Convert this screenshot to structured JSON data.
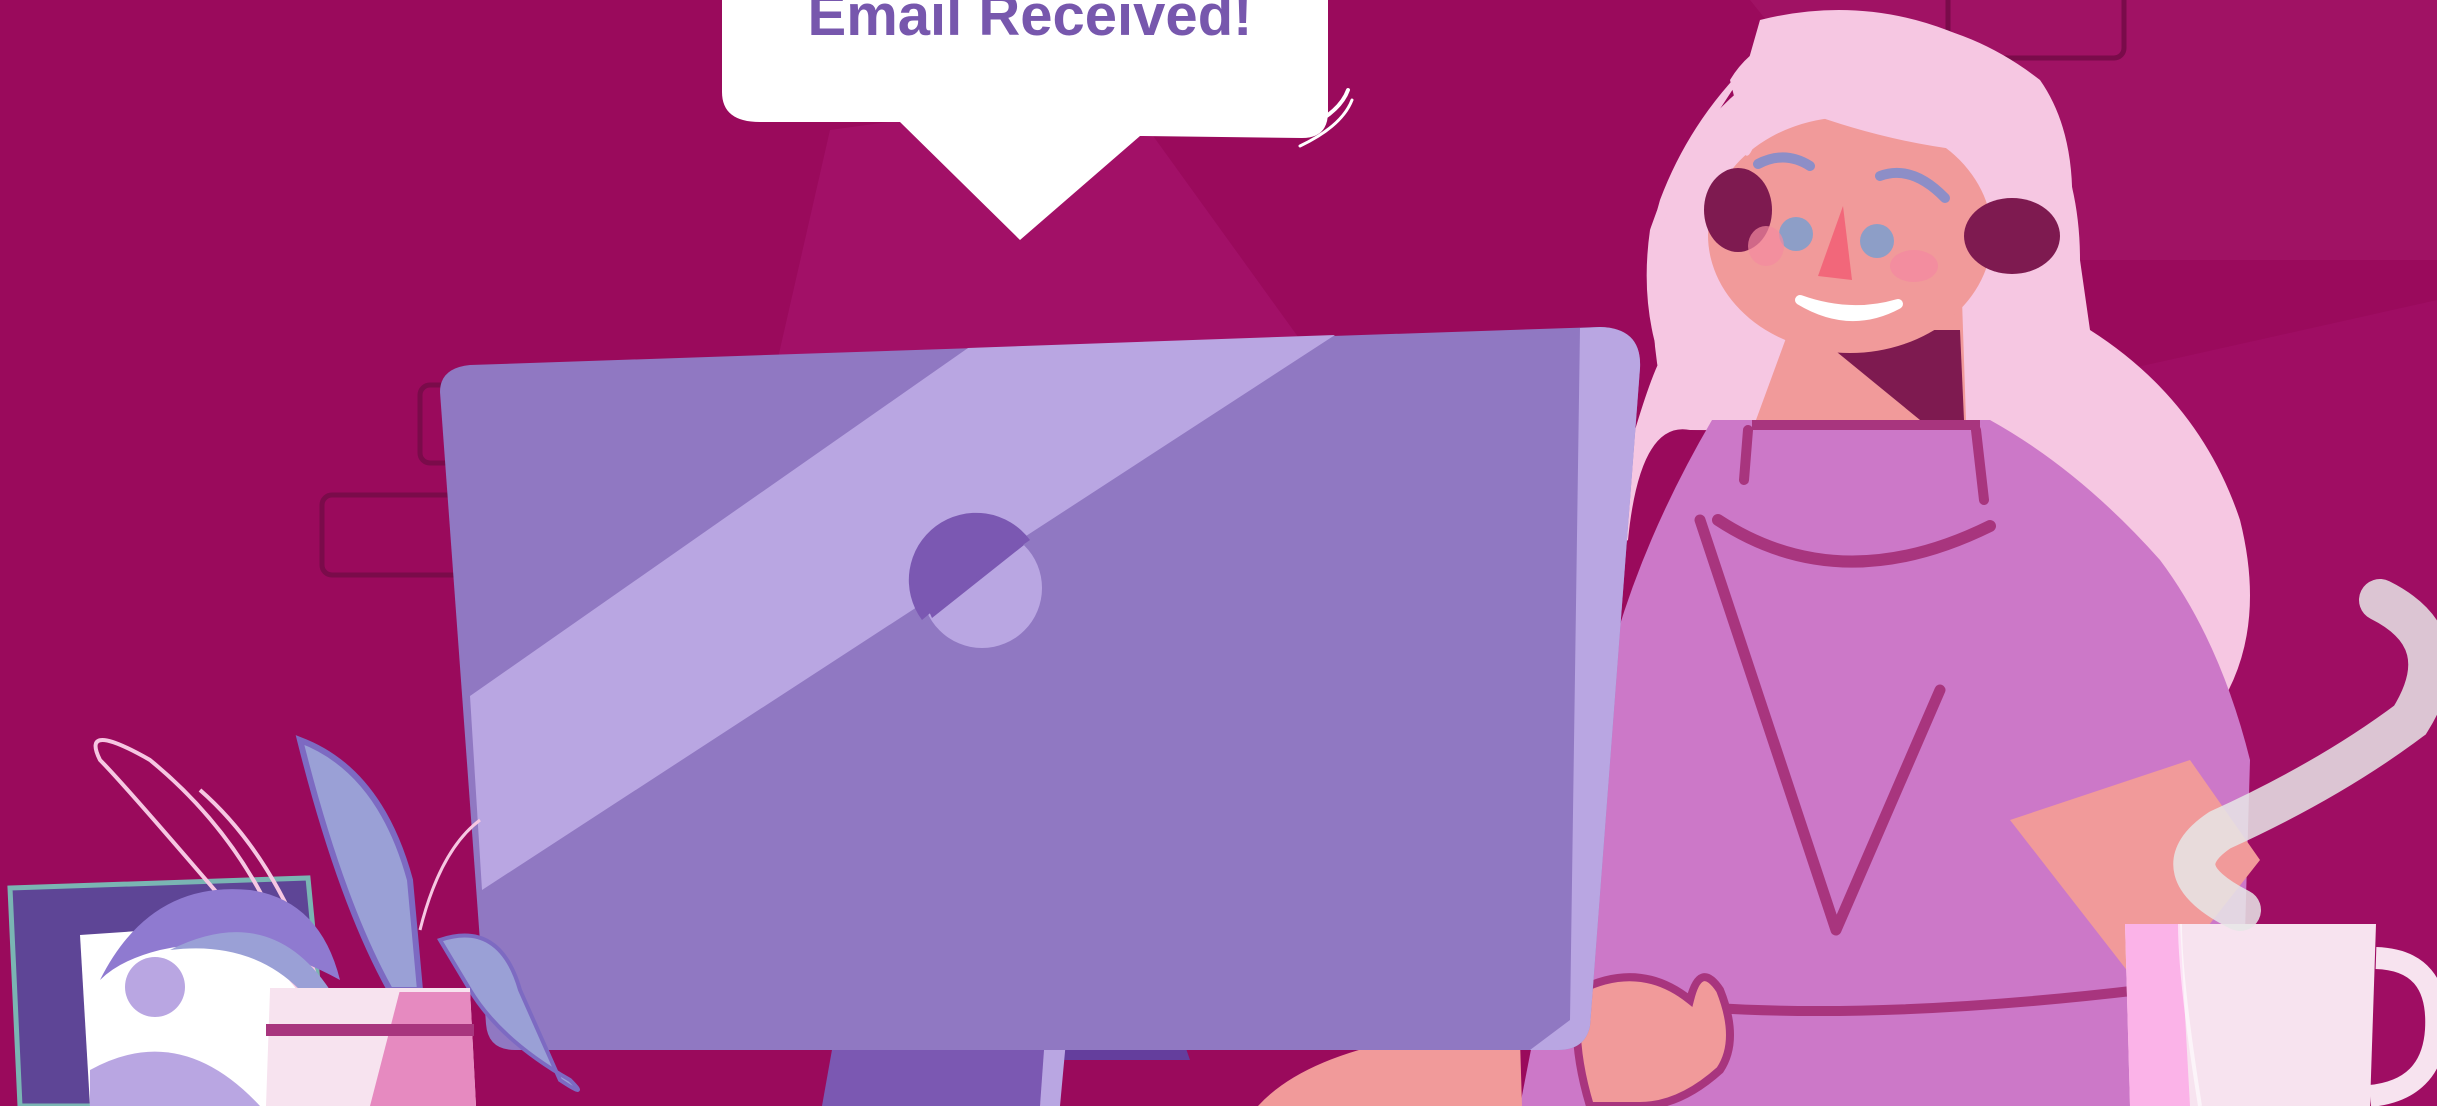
{
  "speech_bubble": {
    "text": "Email Received!"
  },
  "colors": {
    "background": "#9a0a5c",
    "background_light": "#a4126a",
    "bubble": "#ffffff",
    "bubble_text": "#7757ad",
    "monitor_back": "#9078c2",
    "monitor_highlight": "#b9a6e2",
    "monitor_stand": "#7b58b2",
    "hair": "#f6c7e2",
    "skin": "#f19a9a",
    "shirt": "#cc78c8",
    "shirt_lines": "#a8357e",
    "mug": "#f7e3ef",
    "steam": "#e8e8e8"
  },
  "icons": [
    "speech-bubble",
    "monitor-back",
    "woman-illustration",
    "plant-pot",
    "picture-frame",
    "coffee-mug",
    "steam"
  ]
}
